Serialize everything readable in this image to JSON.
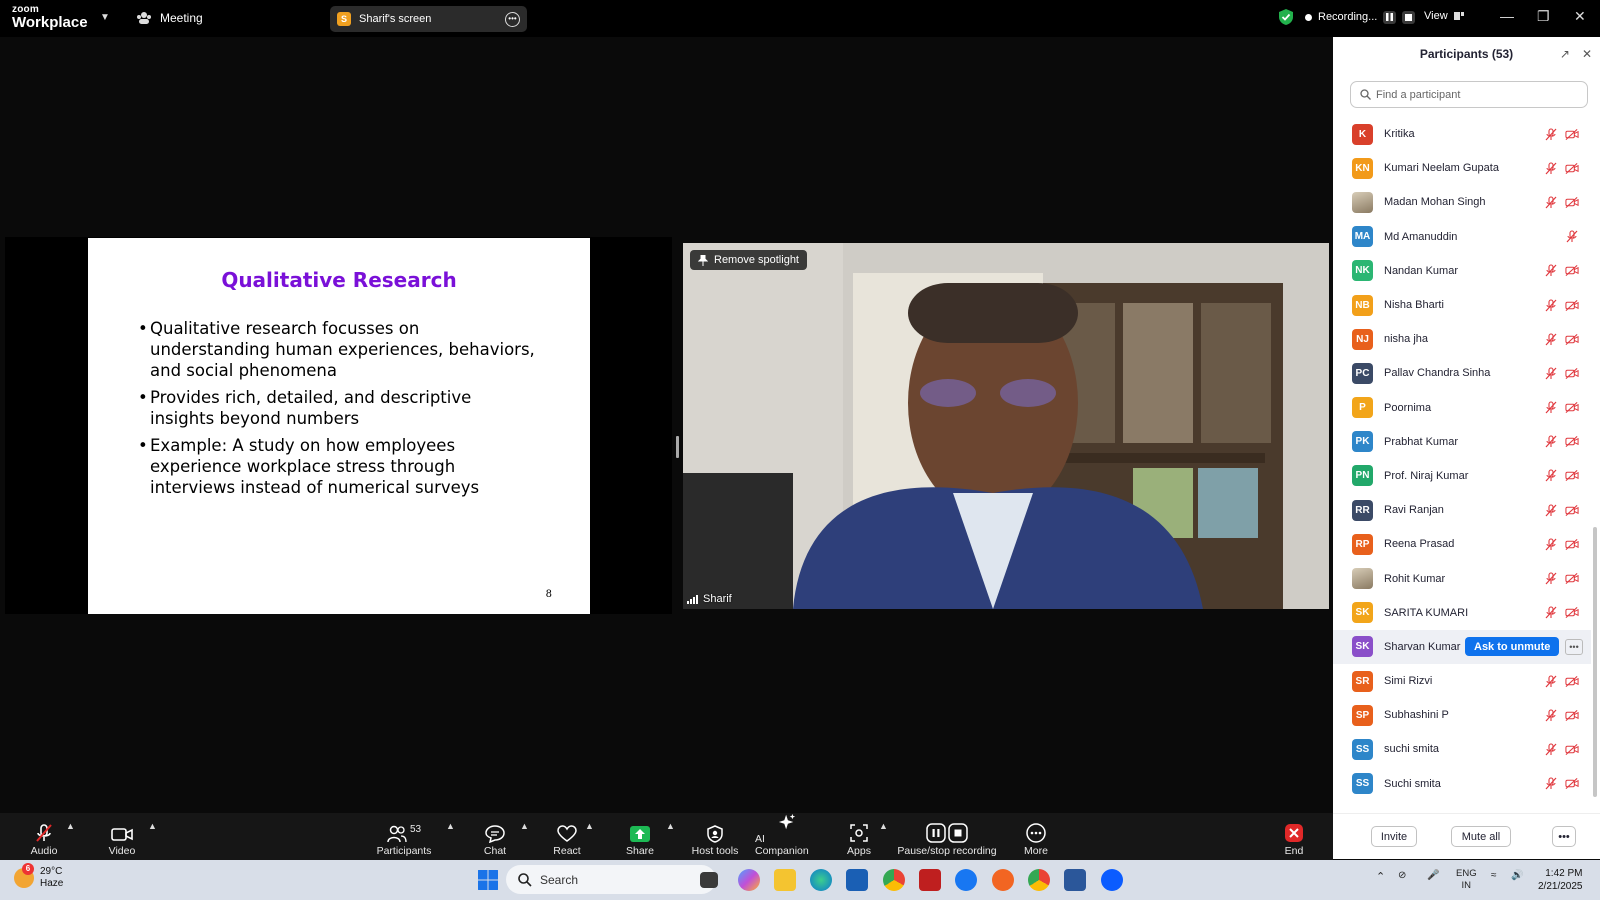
{
  "app": {
    "brand_top": "zoom",
    "brand_bottom": "Workplace",
    "meeting_label": "Meeting"
  },
  "screen_share": {
    "badge": "S",
    "label": "Sharif's screen"
  },
  "recording": {
    "status": "Recording...",
    "view_label": "View"
  },
  "slide": {
    "title": "Qualitative Research",
    "bullets": [
      "Qualitative research focusses on understanding human experiences, behaviors, and social phenomena",
      "Provides rich, detailed, and descriptive insights beyond numbers",
      "Example: A study on how employees experience workplace stress through interviews instead of numerical surveys"
    ],
    "page_number": "8"
  },
  "video": {
    "spotlight_button": "Remove spotlight",
    "speaker_name": "Sharif"
  },
  "participants_panel": {
    "title": "Participants (53)",
    "search_placeholder": "Find a participant",
    "ask_to_unmute": "Ask to unmute",
    "invite": "Invite",
    "mute_all": "Mute all",
    "list": [
      {
        "initials": "K",
        "name": "Kritika",
        "color": "#d9402b",
        "video": true
      },
      {
        "initials": "KN",
        "name": "Kumari Neelam Gupata",
        "color": "#f29a1a",
        "video": true
      },
      {
        "initials": "",
        "name": "Madan Mohan Singh",
        "color": "photo",
        "video": true
      },
      {
        "initials": "MA",
        "name": "Md Amanuddin",
        "color": "#2e86c9",
        "video": false
      },
      {
        "initials": "NK",
        "name": "Nandan Kumar",
        "color": "#2bb673",
        "video": true
      },
      {
        "initials": "NB",
        "name": "Nisha Bharti",
        "color": "#f2a01a",
        "video": true
      },
      {
        "initials": "NJ",
        "name": "nisha jha",
        "color": "#e8601c",
        "video": true
      },
      {
        "initials": "PC",
        "name": "Pallav Chandra Sinha",
        "color": "#3b4a66",
        "video": true
      },
      {
        "initials": "P",
        "name": "Poornima",
        "color": "#f2a51a",
        "video": true
      },
      {
        "initials": "PK",
        "name": "Prabhat Kumar",
        "color": "#2e86c9",
        "video": true
      },
      {
        "initials": "PN",
        "name": "Prof. Niraj Kumar",
        "color": "#22a86a",
        "video": true
      },
      {
        "initials": "RR",
        "name": "Ravi Ranjan",
        "color": "#3b4a66",
        "video": true
      },
      {
        "initials": "RP",
        "name": "Reena Prasad",
        "color": "#e8601c",
        "video": true
      },
      {
        "initials": "",
        "name": "Rohit Kumar",
        "color": "photo",
        "video": true
      },
      {
        "initials": "SK",
        "name": "SARITA KUMARI",
        "color": "#f2a51a",
        "video": true
      },
      {
        "initials": "SK",
        "name": "Sharvan Kumar",
        "color": "#8a4fc9",
        "video": true,
        "highlight": true
      },
      {
        "initials": "SR",
        "name": "Simi Rizvi",
        "color": "#e8601c",
        "video": true
      },
      {
        "initials": "SP",
        "name": "Subhashini P",
        "color": "#e8601c",
        "video": true
      },
      {
        "initials": "SS",
        "name": "suchi smita",
        "color": "#2e86c9",
        "video": true
      },
      {
        "initials": "SS",
        "name": "Suchi smita",
        "color": "#2e86c9",
        "video": true
      }
    ]
  },
  "toolbar": {
    "audio": "Audio",
    "video": "Video",
    "participants": "Participants",
    "participants_count": "53",
    "chat": "Chat",
    "react": "React",
    "share": "Share",
    "host_tools": "Host tools",
    "ai_companion": "AI Companion",
    "apps": "Apps",
    "pause_stop_recording": "Pause/stop recording",
    "more": "More",
    "end": "End"
  },
  "taskbar": {
    "weather_temp": "29°C",
    "weather_desc": "Haze",
    "weather_badge": "6",
    "search": "Search",
    "lang_top": "ENG",
    "lang_bottom": "IN",
    "time": "1:42 PM",
    "date": "2/21/2025"
  },
  "colors": {
    "accent_blue": "#0e72ed",
    "slide_title": "#7a10d8",
    "end_red": "#e02828",
    "share_green": "#1db954"
  }
}
